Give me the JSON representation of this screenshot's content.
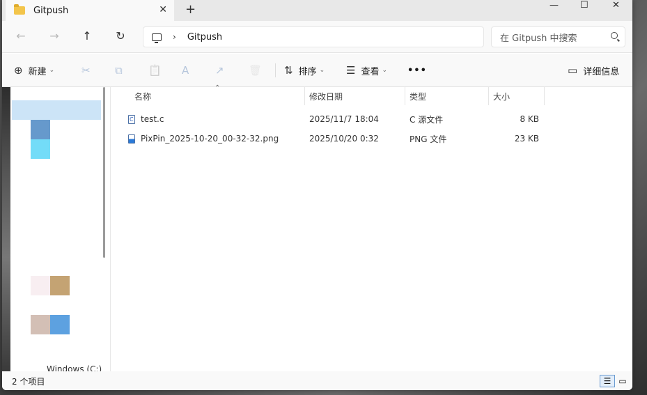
{
  "tab": {
    "title": "Gitpush",
    "close": "✕",
    "new": "+"
  },
  "window_controls": {
    "minimize": "—",
    "maximize": "☐",
    "close": "✕"
  },
  "nav": {
    "back": "←",
    "forward": "→",
    "up": "↑",
    "refresh": "↻",
    "address_chevron": "›",
    "address": "Gitpush",
    "search_placeholder": "在 Gitpush 中搜索"
  },
  "commands": {
    "new_label": "新建",
    "sort_label": "排序",
    "view_label": "查看",
    "more": "•••",
    "details_label": "详细信息",
    "cut_icon": "✂",
    "copy_icon": "⧉",
    "paste_icon": "📋",
    "rename_icon": "A",
    "share_icon": "↗",
    "delete_icon": "🗑"
  },
  "columns": {
    "name": "名称",
    "date": "修改日期",
    "type": "类型",
    "size": "大小"
  },
  "files": [
    {
      "name": "test.c",
      "date": "2025/11/7 18:04",
      "type": "C 源文件",
      "size": "8 KB",
      "icon": "c-file-icon"
    },
    {
      "name": "PixPin_2025-10-20_00-32-32.png",
      "date": "2025/10/20 0:32",
      "type": "PNG 文件",
      "size": "23 KB",
      "icon": "png-file-icon"
    }
  ],
  "sidebar": {
    "partial_item": "Windows (C:)"
  },
  "status": {
    "count": "2 个项目"
  },
  "colors": {
    "selection": "#cce4f7",
    "accent": "#0067c0"
  }
}
